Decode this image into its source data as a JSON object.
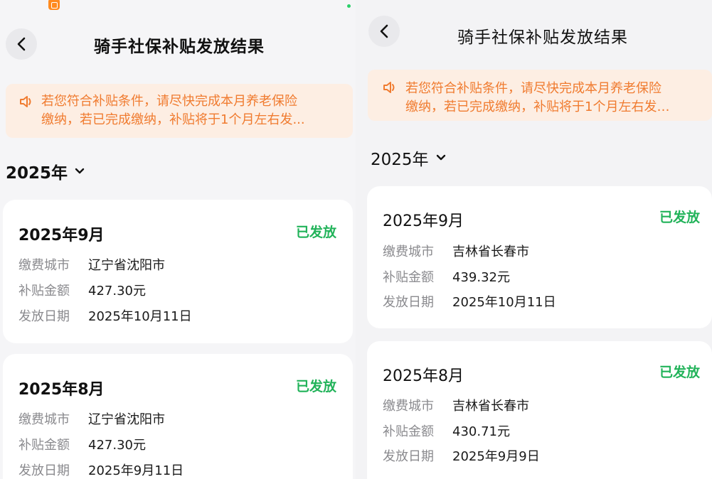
{
  "left": {
    "title": "骑手社保补贴发放结果",
    "notice": {
      "line1": "若您符合补贴条件，请尽快完成本月养老保险",
      "line2": "缴纳，若已完成缴纳，补贴将于1个月左右发..."
    },
    "year": "2025年",
    "cards": [
      {
        "title": "2025年9月",
        "status": "已发放",
        "rows": [
          {
            "label": "缴费城市",
            "value": "辽宁省沈阳市"
          },
          {
            "label": "补贴金额",
            "value": "427.30元"
          },
          {
            "label": "发放日期",
            "value": "2025年10月11日"
          }
        ]
      },
      {
        "title": "2025年8月",
        "status": "已发放",
        "rows": [
          {
            "label": "缴费城市",
            "value": "辽宁省沈阳市"
          },
          {
            "label": "补贴金额",
            "value": "427.30元"
          },
          {
            "label": "发放日期",
            "value": "2025年9月11日"
          }
        ]
      }
    ]
  },
  "right": {
    "title": "骑手社保补贴发放结果",
    "notice": {
      "line1": "若您符合补贴条件，请尽快完成本月养老保险",
      "line2": "缴纳，若已完成缴纳，补贴将于1个月左右发…"
    },
    "year": "2025年",
    "cards": [
      {
        "title": "2025年9月",
        "status": "已发放",
        "rows": [
          {
            "label": "缴费城市",
            "value": "吉林省长春市"
          },
          {
            "label": "补贴金额",
            "value": "439.32元"
          },
          {
            "label": "发放日期",
            "value": "2025年10月11日"
          }
        ]
      },
      {
        "title": "2025年8月",
        "status": "已发放",
        "rows": [
          {
            "label": "缴费城市",
            "value": "吉林省长春市"
          },
          {
            "label": "补贴金额",
            "value": "430.71元"
          },
          {
            "label": "发放日期",
            "value": "2025年9月9日"
          }
        ]
      }
    ]
  },
  "colors": {
    "accent_orange": "#f07b2f",
    "notice_bg": "#fdeee3",
    "status_green": "#22b35a"
  },
  "icons": [
    "chevron-left-icon",
    "speaker-icon",
    "chevron-down-icon"
  ]
}
